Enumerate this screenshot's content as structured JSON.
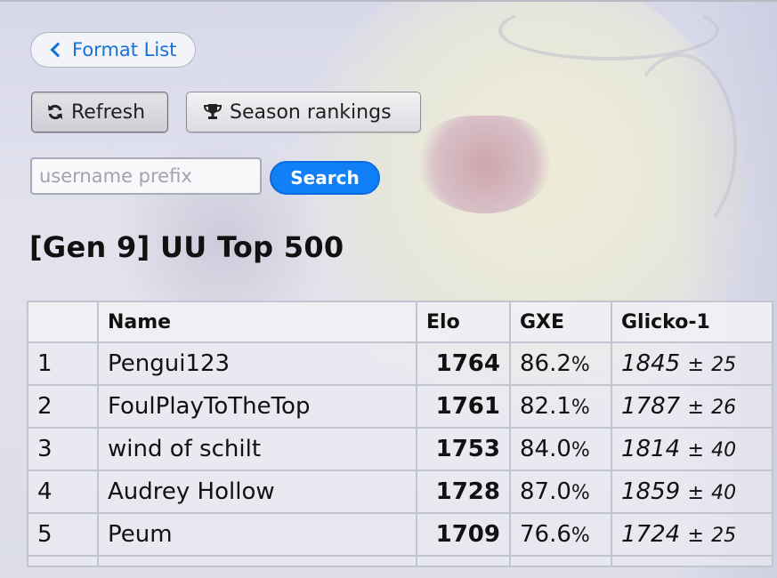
{
  "nav": {
    "format_list_label": "Format List"
  },
  "toolbar": {
    "refresh_label": "Refresh",
    "season_label": "Season rankings"
  },
  "search": {
    "placeholder": "username prefix",
    "button_label": "Search"
  },
  "heading": "[Gen 9] UU Top 500",
  "table": {
    "columns": [
      "",
      "Name",
      "Elo",
      "GXE",
      "Glicko-1"
    ],
    "rows": [
      {
        "rank": "1",
        "name": "Pengui123",
        "elo": "1764",
        "gxe": "86.2",
        "glicko": "1845",
        "dev": "25"
      },
      {
        "rank": "2",
        "name": "FoulPlayToTheTop",
        "elo": "1761",
        "gxe": "82.1",
        "glicko": "1787",
        "dev": "26"
      },
      {
        "rank": "3",
        "name": "wind of schilt",
        "elo": "1753",
        "gxe": "84.0",
        "glicko": "1814",
        "dev": "40"
      },
      {
        "rank": "4",
        "name": "Audrey Hollow",
        "elo": "1728",
        "gxe": "87.0",
        "glicko": "1859",
        "dev": "40"
      },
      {
        "rank": "5",
        "name": "Peum",
        "elo": "1709",
        "gxe": "76.6",
        "glicko": "1724",
        "dev": "25"
      }
    ]
  },
  "colors": {
    "accent": "#117ff5",
    "link": "#1671d8"
  },
  "icons": {
    "back": "chevron-left-icon",
    "refresh": "refresh-icon",
    "season": "trophy-icon"
  }
}
